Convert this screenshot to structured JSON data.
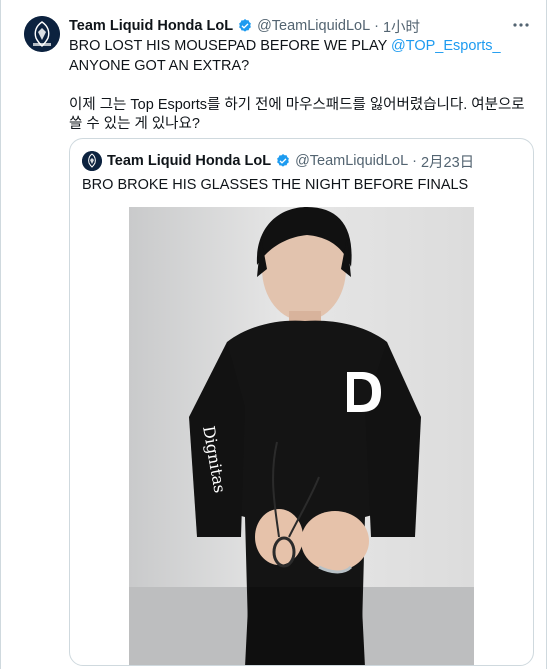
{
  "tweet": {
    "author_name": "Team Liquid Honda LoL",
    "author_handle": "@TeamLiquidLoL",
    "separator": "·",
    "time": "1小时",
    "text_before_mention": "BRO LOST HIS MOUSEPAD BEFORE WE PLAY ",
    "mention": "@TOP_Esports_",
    "text_after_mention": " ANYONE GOT AN EXTRA?",
    "translation": "이제 그는 Top Esports를 하기 전에 마우스패드를 잃어버렸습니다. 여분으로 쓸 수 있는 게 있나요?",
    "more_icon": "more-horizontal-icon",
    "verified_icon": "verified-badge-icon"
  },
  "quoted_tweet": {
    "author_name": "Team Liquid Honda LoL",
    "author_handle": "@TeamLiquidLoL",
    "separator": "·",
    "time": "2月23日",
    "text": "BRO BROKE HIS GLASSES THE NIGHT BEFORE FINALS"
  },
  "colors": {
    "link": "#1d9bf0",
    "verified": "#1d9bf0",
    "secondary_text": "#536471",
    "border": "#cfd9de",
    "avatar_bg": "#0c223f"
  }
}
